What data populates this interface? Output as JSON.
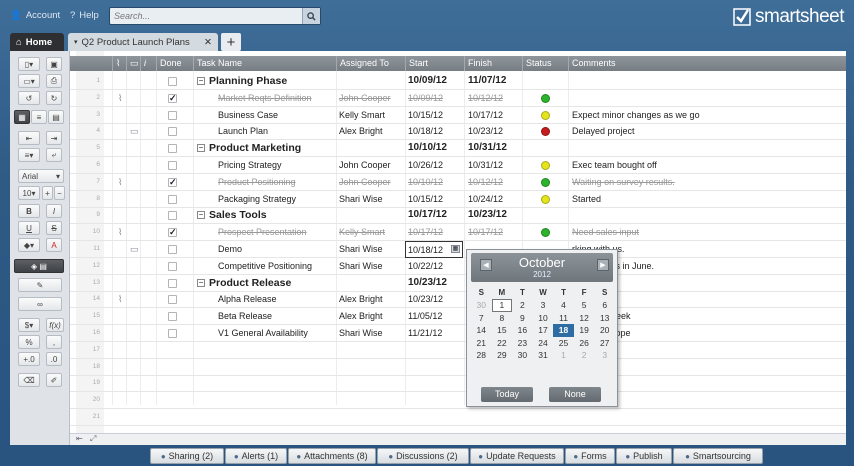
{
  "topbar": {
    "account": "Account",
    "help": "Help",
    "search_placeholder": "Search...",
    "logo": "smartsheet"
  },
  "tabs": {
    "home": "Home",
    "sheet": "Q2 Product Launch Plans",
    "add": "+"
  },
  "columns": {
    "done": "Done",
    "task": "Task Name",
    "assigned": "Assigned To",
    "start": "Start",
    "finish": "Finish",
    "status": "Status",
    "comments": "Comments"
  },
  "colors": {
    "green": "#2bb32b",
    "yellow": "#e4e41d",
    "red": "#c41d1d",
    "accent": "#2e6da4"
  },
  "rows": [
    {
      "n": "1",
      "task": "Planning Phase",
      "assigned": "",
      "start": "10/09/12",
      "finish": "11/07/12",
      "status": "",
      "comment": "",
      "parent": true,
      "done": false,
      "strike": false,
      "attach": false,
      "disc": false
    },
    {
      "n": "2",
      "task": "Market Reqts Definition",
      "assigned": "John Cooper",
      "start": "10/09/12",
      "finish": "10/12/12",
      "status": "green",
      "comment": "",
      "parent": false,
      "done": true,
      "strike": true,
      "attach": true,
      "disc": false
    },
    {
      "n": "3",
      "task": "Business Case",
      "assigned": "Kelly Smart",
      "start": "10/15/12",
      "finish": "10/17/12",
      "status": "yellow",
      "comment": "Expect minor changes as we go",
      "parent": false,
      "done": false,
      "strike": false,
      "attach": false,
      "disc": false
    },
    {
      "n": "4",
      "task": "Launch Plan",
      "assigned": "Alex Bright",
      "start": "10/18/12",
      "finish": "10/23/12",
      "status": "red",
      "comment": "Delayed project",
      "parent": false,
      "done": false,
      "strike": false,
      "attach": false,
      "disc": true
    },
    {
      "n": "5",
      "task": "Product Marketing",
      "assigned": "",
      "start": "10/10/12",
      "finish": "10/31/12",
      "status": "",
      "comment": "",
      "parent": true,
      "done": false,
      "strike": false,
      "attach": false,
      "disc": false
    },
    {
      "n": "6",
      "task": "Pricing Strategy",
      "assigned": "John Cooper",
      "start": "10/26/12",
      "finish": "10/31/12",
      "status": "yellow",
      "comment": "Exec team bought off",
      "parent": false,
      "done": false,
      "strike": false,
      "attach": false,
      "disc": false
    },
    {
      "n": "7",
      "task": "Product Positioning",
      "assigned": "John Cooper",
      "start": "10/10/12",
      "finish": "10/12/12",
      "status": "green",
      "comment": "Waiting on survey results.",
      "parent": false,
      "done": true,
      "strike": true,
      "attach": true,
      "disc": false
    },
    {
      "n": "8",
      "task": "Packaging Strategy",
      "assigned": "Shari Wise",
      "start": "10/15/12",
      "finish": "10/24/12",
      "status": "yellow",
      "comment": "Started",
      "parent": false,
      "done": false,
      "strike": false,
      "attach": false,
      "disc": false
    },
    {
      "n": "9",
      "task": "Sales Tools",
      "assigned": "",
      "start": "10/17/12",
      "finish": "10/23/12",
      "status": "",
      "comment": "",
      "parent": true,
      "done": false,
      "strike": false,
      "attach": false,
      "disc": false
    },
    {
      "n": "10",
      "task": "Prospect Presentation",
      "assigned": "Kelly Smart",
      "start": "10/17/12",
      "finish": "10/17/12",
      "status": "green",
      "comment": "Need sales input",
      "parent": false,
      "done": true,
      "strike": true,
      "attach": true,
      "disc": false
    },
    {
      "n": "11",
      "task": "Demo",
      "assigned": "Shari Wise",
      "start": "10/18/12",
      "finish": "",
      "status": "",
      "comment": "rking with us.",
      "parent": false,
      "done": false,
      "strike": false,
      "attach": false,
      "disc": true
    },
    {
      "n": "12",
      "task": "Competitive Positioning",
      "assigned": "Shari Wise",
      "start": "10/22/12",
      "finish": "",
      "status": "",
      "comment": "work on this in June.",
      "parent": false,
      "done": false,
      "strike": false,
      "attach": false,
      "disc": false
    },
    {
      "n": "13",
      "task": "Product Release",
      "assigned": "",
      "start": "10/23/12",
      "finish": "",
      "status": "",
      "comment": "",
      "parent": true,
      "done": false,
      "strike": false,
      "attach": false,
      "disc": false
    },
    {
      "n": "14",
      "task": "Alpha Release",
      "assigned": "Alex Bright",
      "start": "10/23/12",
      "finish": "",
      "status": "",
      "comment": "",
      "parent": false,
      "done": false,
      "strike": false,
      "attach": true,
      "disc": false
    },
    {
      "n": "15",
      "task": "Beta Release",
      "assigned": "Alex Bright",
      "start": "11/05/12",
      "finish": "",
      "status": "",
      "comment": "Beta this week",
      "parent": false,
      "done": false,
      "strike": false,
      "attach": false,
      "disc": false
    },
    {
      "n": "16",
      "task": "V1 General Availability",
      "assigned": "Shari Wise",
      "start": "11/21/12",
      "finish": "",
      "status": "",
      "comment": "alize V1 scope",
      "parent": false,
      "done": false,
      "strike": false,
      "attach": false,
      "disc": false
    },
    {
      "n": "17",
      "task": "",
      "assigned": "",
      "start": "",
      "finish": "",
      "status": "",
      "comment": "",
      "parent": false,
      "done": false,
      "strike": false,
      "attach": false,
      "disc": false
    },
    {
      "n": "18",
      "task": "",
      "assigned": "",
      "start": "",
      "finish": "",
      "status": "",
      "comment": "",
      "parent": false,
      "done": false,
      "strike": false,
      "attach": false,
      "disc": false
    },
    {
      "n": "19",
      "task": "",
      "assigned": "",
      "start": "",
      "finish": "",
      "status": "",
      "comment": "",
      "parent": false,
      "done": false,
      "strike": false,
      "attach": false,
      "disc": false
    },
    {
      "n": "20",
      "task": "",
      "assigned": "",
      "start": "",
      "finish": "",
      "status": "",
      "comment": "",
      "parent": false,
      "done": false,
      "strike": false,
      "attach": false,
      "disc": false
    },
    {
      "n": "21",
      "task": "",
      "assigned": "",
      "start": "",
      "finish": "",
      "status": "",
      "comment": "",
      "parent": false,
      "done": false,
      "strike": false,
      "attach": false,
      "disc": false
    }
  ],
  "calendar": {
    "month": "October",
    "year": "2012",
    "days": [
      "S",
      "M",
      "T",
      "W",
      "T",
      "F",
      "S"
    ],
    "weeks": [
      [
        "30",
        "1",
        "2",
        "3",
        "4",
        "5",
        "6"
      ],
      [
        "7",
        "8",
        "9",
        "10",
        "11",
        "12",
        "13"
      ],
      [
        "14",
        "15",
        "16",
        "17",
        "18",
        "19",
        "20"
      ],
      [
        "21",
        "22",
        "23",
        "24",
        "25",
        "26",
        "27"
      ],
      [
        "28",
        "29",
        "30",
        "31",
        "1",
        "2",
        "3"
      ]
    ],
    "selected": "18",
    "today": "1",
    "today_label": "Today",
    "none_label": "None"
  },
  "toolbar": {
    "font": "Arial",
    "size": "10",
    "bold": "B",
    "italic": "I",
    "underline": "U",
    "strike": "S",
    "currency": "$",
    "percent": "%",
    "function": "f(x)",
    "comma": ","
  },
  "bottom": [
    {
      "icon": "sharing-icon",
      "label": "Sharing (2)"
    },
    {
      "icon": "alert-icon",
      "label": "Alerts (1)"
    },
    {
      "icon": "attachment-icon",
      "label": "Attachments (8)"
    },
    {
      "icon": "discussion-icon",
      "label": "Discussions (2)"
    },
    {
      "icon": "update-icon",
      "label": "Update Requests"
    },
    {
      "icon": "forms-icon",
      "label": "Forms"
    },
    {
      "icon": "publish-icon",
      "label": "Publish"
    },
    {
      "icon": "smartsourcing-icon",
      "label": "Smartsourcing"
    }
  ]
}
